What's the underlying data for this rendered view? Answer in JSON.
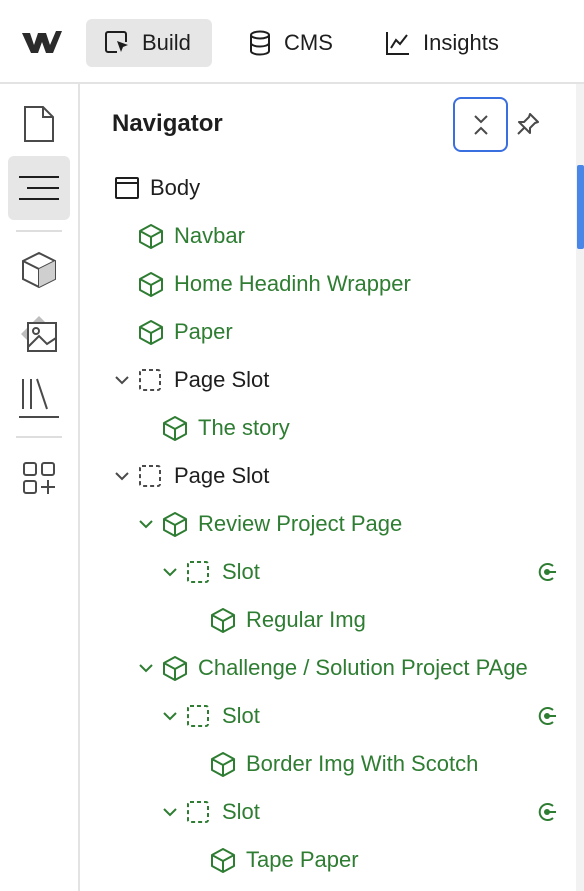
{
  "colors": {
    "accent": "#3a6fe0",
    "component": "#2e7d32",
    "active_bg": "#e6e6e6"
  },
  "topbar": {
    "logo_icon": "webflow-logo-icon",
    "tabs": [
      {
        "label": "Build",
        "icon": "cursor-select-icon",
        "active": true
      },
      {
        "label": "CMS",
        "icon": "database-icon",
        "active": false
      },
      {
        "label": "Insights",
        "icon": "line-chart-icon",
        "active": false
      }
    ]
  },
  "rail": {
    "items": [
      "page-icon",
      "navigator-icon",
      "components-icon",
      "assets-icon",
      "libraries-icon",
      "apps-icon"
    ],
    "active": "navigator-icon"
  },
  "navigator": {
    "title": "Navigator",
    "collapse_icon": "collapse-all-icon",
    "pin_icon": "pin-icon",
    "tree": [
      {
        "label": "Body",
        "type": "body"
      },
      {
        "label": "Navbar",
        "type": "component"
      },
      {
        "label": "Home Headinh Wrapper",
        "type": "component"
      },
      {
        "label": "Paper",
        "type": "component"
      },
      {
        "label": "Page Slot",
        "type": "slot",
        "expanded": true
      },
      {
        "label": "The story",
        "type": "component"
      },
      {
        "label": "Page Slot",
        "type": "slot",
        "expanded": true
      },
      {
        "label": "Review Project Page",
        "type": "component",
        "expanded": true
      },
      {
        "label": "Slot",
        "type": "component-slot",
        "expanded": true,
        "badge": "slot-target-icon"
      },
      {
        "label": "Regular Img",
        "type": "component"
      },
      {
        "label": "Challenge / Solution Project PAge",
        "type": "component",
        "expanded": true
      },
      {
        "label": "Slot",
        "type": "component-slot",
        "expanded": true,
        "badge": "slot-target-icon"
      },
      {
        "label": "Border Img With Scotch",
        "type": "component"
      },
      {
        "label": "Slot",
        "type": "component-slot",
        "expanded": true,
        "badge": "slot-target-icon"
      },
      {
        "label": "Tape Paper",
        "type": "component"
      }
    ]
  }
}
